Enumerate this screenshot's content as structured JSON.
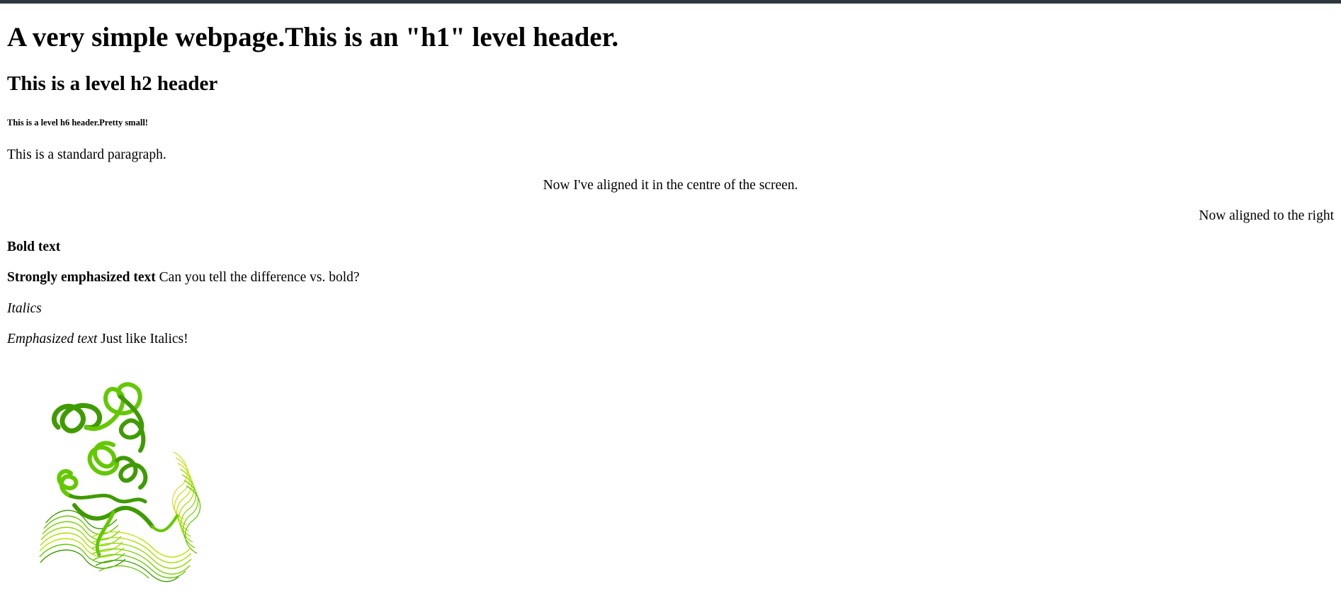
{
  "header_h1": "A very simple webpage.This is an \"h1\" level header.",
  "header_h2": "This is a level h2 header",
  "header_h6": "This is a level h6 header.Pretty small!",
  "para_standard": "This is a standard paragraph.",
  "para_center": "Now I've aligned it in the centre of the screen.",
  "para_right": "Now aligned to the right",
  "bold_text": "Bold text",
  "strong_text": "Strongly emphasized text",
  "strong_trailing": " Can you tell the difference vs. bold?",
  "italic_text": "Italics",
  "em_text": "Emphasized text",
  "em_trailing": " Just like Italics!",
  "image": {
    "name": "protein-ribbon-image",
    "colors": {
      "ribbon_dark": "#3f9b00",
      "ribbon_mid": "#63c800",
      "ribbon_light": "#b9e600",
      "ribbon_yellow": "#dada3a"
    }
  },
  "colors": {
    "top_bar": "#2f3740",
    "text": "#000000",
    "background": "#ffffff"
  }
}
